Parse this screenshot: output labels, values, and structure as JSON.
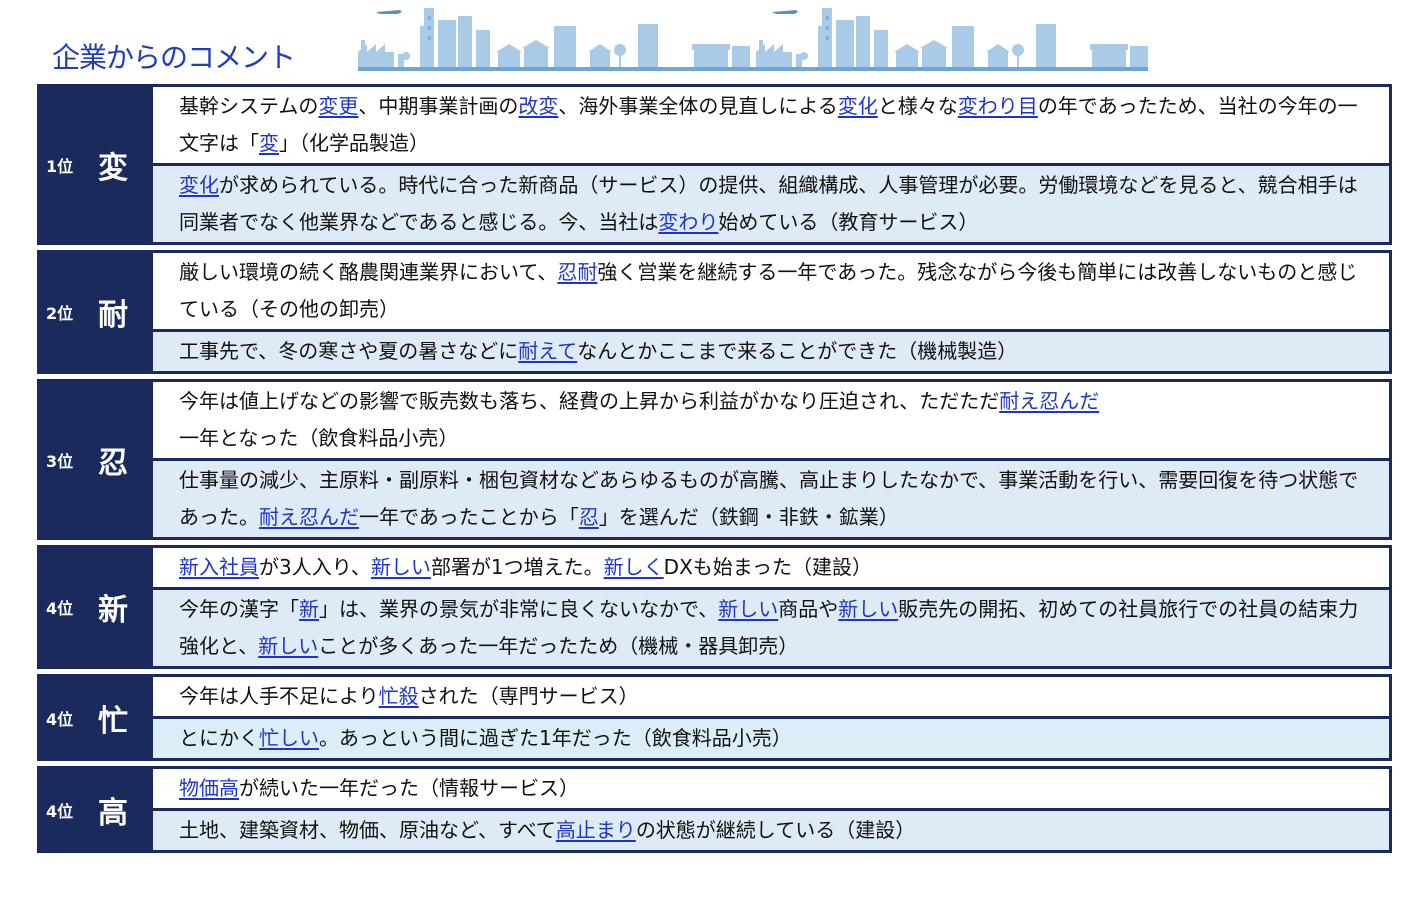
{
  "title": "企業からのコメント",
  "colors": {
    "title": "#1f3dbf",
    "frame": "#1b2a5c",
    "highlight": "#1f35c9",
    "row_alt": "#deeaf6"
  },
  "groups": [
    {
      "rank": "1位",
      "kanji": "変",
      "rows": [
        {
          "bg": "white",
          "parts": [
            {
              "t": "基幹システムの"
            },
            {
              "t": "変更",
              "hl": true
            },
            {
              "t": "、中期事業計画の"
            },
            {
              "t": "改変",
              "hl": true
            },
            {
              "t": "、海外事業全体の見直しによる"
            },
            {
              "t": "変化",
              "hl": true
            },
            {
              "t": "と様々な"
            },
            {
              "t": "変わり目",
              "hl": true
            },
            {
              "t": "の年であったため、当社の今年の一文字は「"
            },
            {
              "t": "変",
              "hl": true
            },
            {
              "t": "」（化学品製造）"
            }
          ]
        },
        {
          "bg": "blue",
          "parts": [
            {
              "t": "変化",
              "hl": true
            },
            {
              "t": "が求められている。時代に合った新商品（サービス）の提供、組織構成、人事管理が必要。労働環境などを見ると、競合相手は同業者でなく他業界などであると感じる。今、当社は"
            },
            {
              "t": "変わり",
              "hl": true
            },
            {
              "t": "始めている（教育サービス）"
            }
          ]
        }
      ]
    },
    {
      "rank": "2位",
      "kanji": "耐",
      "rows": [
        {
          "bg": "white",
          "parts": [
            {
              "t": "厳しい環境の続く酪農関連業界において、"
            },
            {
              "t": "忍耐",
              "hl": true
            },
            {
              "t": "強く営業を継続する一年であった。残念ながら今後も簡単には改善しないものと感じている（その他の卸売）"
            }
          ]
        },
        {
          "bg": "blue",
          "parts": [
            {
              "t": "工事先で、冬の寒さや夏の暑さなどに"
            },
            {
              "t": "耐えて",
              "hl": true
            },
            {
              "t": "なんとかここまで来ることができた（機械製造）"
            }
          ]
        }
      ]
    },
    {
      "rank": "3位",
      "kanji": "忍",
      "rows": [
        {
          "bg": "white",
          "parts": [
            {
              "t": "今年は値上げなどの影響で販売数も落ち、経費の上昇から利益がかなり圧迫され、ただただ"
            },
            {
              "t": "耐え忍んだ",
              "hl": true
            },
            {
              "t": "一年となった（飲食料品小売）"
            }
          ]
        },
        {
          "bg": "blue",
          "parts": [
            {
              "t": "仕事量の減少、主原料・副原料・梱包資材などあらゆるものが高騰、高止まりしたなかで、事業活動を行い、需要回復を待つ状態であった。"
            },
            {
              "t": "耐え忍んだ",
              "hl": true
            },
            {
              "t": "一年であったことから「"
            },
            {
              "t": "忍",
              "hl": true
            },
            {
              "t": "」を選んだ（鉄鋼・非鉄・鉱業）"
            }
          ]
        }
      ]
    },
    {
      "rank": "4位",
      "kanji": "新",
      "rows": [
        {
          "bg": "white",
          "parts": [
            {
              "t": "新入社員",
              "hl": true
            },
            {
              "t": "が3人入り、"
            },
            {
              "t": "新しい",
              "hl": true
            },
            {
              "t": "部署が1つ増えた。"
            },
            {
              "t": "新しく",
              "hl": true
            },
            {
              "t": "DXも始まった（建設）"
            }
          ]
        },
        {
          "bg": "blue",
          "parts": [
            {
              "t": "今年の漢字「"
            },
            {
              "t": "新",
              "hl": true
            },
            {
              "t": "」は、業界の景気が非常に良くないなかで、"
            },
            {
              "t": "新しい",
              "hl": true
            },
            {
              "t": "商品や"
            },
            {
              "t": "新しい",
              "hl": true
            },
            {
              "t": "販売先の開拓、初めての社員旅行での社員の結束力強化と、"
            },
            {
              "t": "新しい",
              "hl": true
            },
            {
              "t": "ことが多くあった一年だったため（機械・器具卸売）"
            }
          ]
        }
      ]
    },
    {
      "rank": "4位",
      "kanji": "忙",
      "rows": [
        {
          "bg": "white",
          "parts": [
            {
              "t": "今年は人手不足により"
            },
            {
              "t": "忙殺",
              "hl": true
            },
            {
              "t": "された（専門サービス）"
            }
          ]
        },
        {
          "bg": "lblue",
          "parts": [
            {
              "t": "とにかく"
            },
            {
              "t": "忙しい",
              "hl": true
            },
            {
              "t": "。あっという間に過ぎた1年だった（飲食料品小売）"
            }
          ]
        }
      ]
    },
    {
      "rank": "4位",
      "kanji": "高",
      "rows": [
        {
          "bg": "white",
          "parts": [
            {
              "t": "物価高",
              "hl": true
            },
            {
              "t": "が続いた一年だった（情報サービス）"
            }
          ]
        },
        {
          "bg": "blue",
          "parts": [
            {
              "t": "土地、建築資材、物価、原油など、すべて"
            },
            {
              "t": "高止まり",
              "hl": true
            },
            {
              "t": "の状態が継続している（建設）"
            }
          ]
        }
      ]
    }
  ]
}
